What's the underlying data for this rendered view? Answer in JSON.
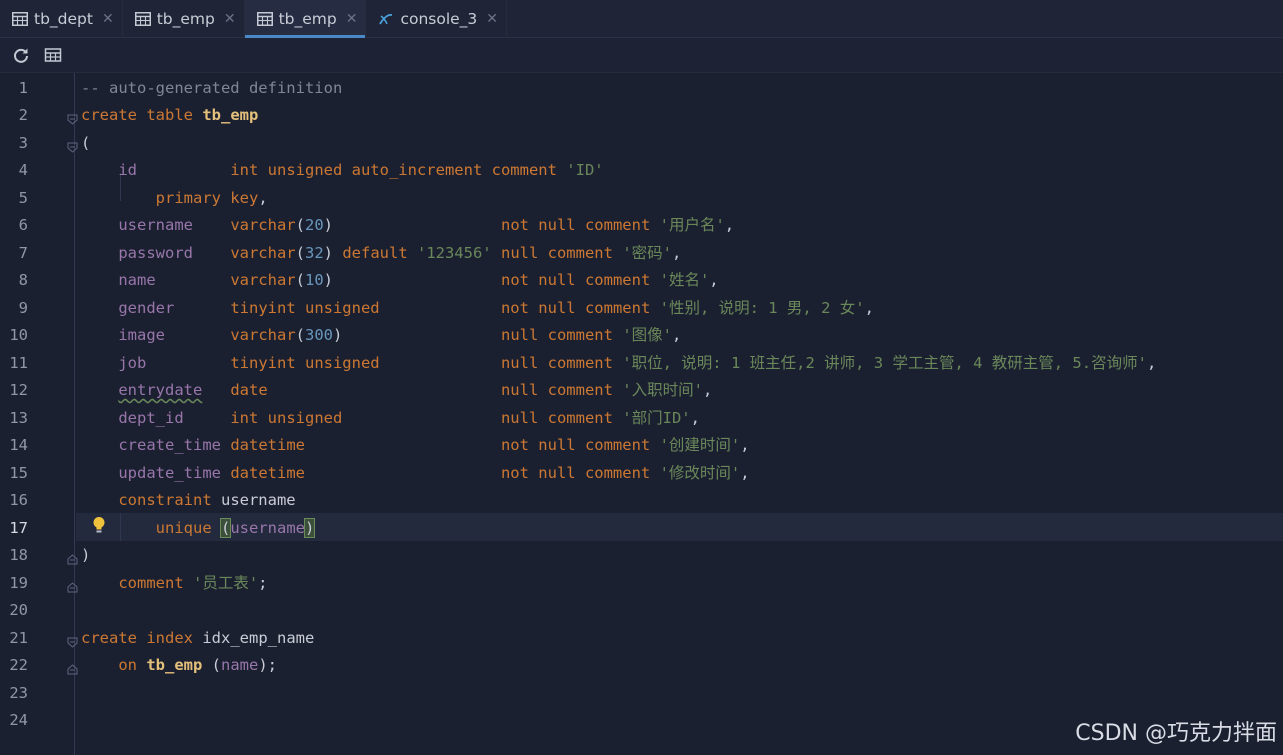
{
  "tabs": [
    {
      "label": "tb_dept",
      "icon": "table-icon",
      "active": false
    },
    {
      "label": "tb_emp",
      "icon": "table-icon",
      "active": false
    },
    {
      "label": "tb_emp",
      "icon": "table-icon",
      "active": true
    },
    {
      "label": "console_3",
      "icon": "console-icon",
      "active": false
    }
  ],
  "toolbar": {
    "buttons": [
      {
        "icon": "refresh-icon"
      },
      {
        "icon": "table-view-icon"
      }
    ]
  },
  "editor": {
    "current_line": 17,
    "line_numbers": [
      "1",
      "2",
      "3",
      "4",
      "5",
      "6",
      "7",
      "8",
      "9",
      "10",
      "11",
      "12",
      "13",
      "14",
      "15",
      "16",
      "17",
      "18",
      "19",
      "20",
      "21",
      "22",
      "23",
      "24"
    ],
    "lines": [
      [
        {
          "t": "-- auto-generated definition",
          "c": "cm"
        }
      ],
      [
        {
          "t": "create table ",
          "c": "kw"
        },
        {
          "t": "tb_emp",
          "c": "tb"
        }
      ],
      [
        {
          "t": "(",
          "c": "par"
        }
      ],
      [
        {
          "t": "    "
        },
        {
          "t": "id",
          "c": "fld"
        },
        {
          "t": "          "
        },
        {
          "t": "int unsigned auto_increment comment ",
          "c": "kw"
        },
        {
          "t": "'ID'",
          "c": "str"
        }
      ],
      [
        {
          "t": "        "
        },
        {
          "t": "primary key",
          "c": "kw"
        },
        {
          "t": ",",
          "c": "par"
        }
      ],
      [
        {
          "t": "    "
        },
        {
          "t": "username",
          "c": "fld"
        },
        {
          "t": "    "
        },
        {
          "t": "varchar",
          "c": "kw"
        },
        {
          "t": "(",
          "c": "par"
        },
        {
          "t": "20",
          "c": "num"
        },
        {
          "t": ")",
          "c": "par"
        },
        {
          "t": "                  "
        },
        {
          "t": "not null comment ",
          "c": "kw"
        },
        {
          "t": "'用户名'",
          "c": "str"
        },
        {
          "t": ",",
          "c": "par"
        }
      ],
      [
        {
          "t": "    "
        },
        {
          "t": "password",
          "c": "fld"
        },
        {
          "t": "    "
        },
        {
          "t": "varchar",
          "c": "kw"
        },
        {
          "t": "(",
          "c": "par"
        },
        {
          "t": "32",
          "c": "num"
        },
        {
          "t": ") ",
          "c": "par"
        },
        {
          "t": "default ",
          "c": "kw"
        },
        {
          "t": "'123456' ",
          "c": "str"
        },
        {
          "t": "null comment ",
          "c": "kw"
        },
        {
          "t": "'密码'",
          "c": "str"
        },
        {
          "t": ",",
          "c": "par"
        }
      ],
      [
        {
          "t": "    "
        },
        {
          "t": "name",
          "c": "fld"
        },
        {
          "t": "        "
        },
        {
          "t": "varchar",
          "c": "kw"
        },
        {
          "t": "(",
          "c": "par"
        },
        {
          "t": "10",
          "c": "num"
        },
        {
          "t": ")",
          "c": "par"
        },
        {
          "t": "                  "
        },
        {
          "t": "not null comment ",
          "c": "kw"
        },
        {
          "t": "'姓名'",
          "c": "str"
        },
        {
          "t": ",",
          "c": "par"
        }
      ],
      [
        {
          "t": "    "
        },
        {
          "t": "gender",
          "c": "fld"
        },
        {
          "t": "      "
        },
        {
          "t": "tinyint unsigned",
          "c": "kw"
        },
        {
          "t": "             "
        },
        {
          "t": "not null comment ",
          "c": "kw"
        },
        {
          "t": "'性别, 说明: 1 男, 2 女'",
          "c": "str"
        },
        {
          "t": ",",
          "c": "par"
        }
      ],
      [
        {
          "t": "    "
        },
        {
          "t": "image",
          "c": "fld"
        },
        {
          "t": "       "
        },
        {
          "t": "varchar",
          "c": "kw"
        },
        {
          "t": "(",
          "c": "par"
        },
        {
          "t": "300",
          "c": "num"
        },
        {
          "t": ")",
          "c": "par"
        },
        {
          "t": "                 "
        },
        {
          "t": "null comment ",
          "c": "kw"
        },
        {
          "t": "'图像'",
          "c": "str"
        },
        {
          "t": ",",
          "c": "par"
        }
      ],
      [
        {
          "t": "    "
        },
        {
          "t": "job",
          "c": "fld"
        },
        {
          "t": "         "
        },
        {
          "t": "tinyint unsigned",
          "c": "kw"
        },
        {
          "t": "             "
        },
        {
          "t": "null comment ",
          "c": "kw"
        },
        {
          "t": "'职位, 说明: 1 班主任,2 讲师, 3 学工主管, 4 教研主管, 5.咨询师'",
          "c": "str"
        },
        {
          "t": ",",
          "c": "par"
        }
      ],
      [
        {
          "t": "    "
        },
        {
          "t": "entrydate",
          "c": "fld wavy"
        },
        {
          "t": "   "
        },
        {
          "t": "date",
          "c": "kw"
        },
        {
          "t": "                         "
        },
        {
          "t": "null comment ",
          "c": "kw"
        },
        {
          "t": "'入职时间'",
          "c": "str"
        },
        {
          "t": ",",
          "c": "par"
        }
      ],
      [
        {
          "t": "    "
        },
        {
          "t": "dept_id",
          "c": "fld"
        },
        {
          "t": "     "
        },
        {
          "t": "int unsigned",
          "c": "kw"
        },
        {
          "t": "                 "
        },
        {
          "t": "null comment ",
          "c": "kw"
        },
        {
          "t": "'部门ID'",
          "c": "str"
        },
        {
          "t": ",",
          "c": "par"
        }
      ],
      [
        {
          "t": "    "
        },
        {
          "t": "create_time",
          "c": "fld"
        },
        {
          "t": " "
        },
        {
          "t": "datetime",
          "c": "kw"
        },
        {
          "t": "                     "
        },
        {
          "t": "not null comment ",
          "c": "kw"
        },
        {
          "t": "'创建时间'",
          "c": "str"
        },
        {
          "t": ",",
          "c": "par"
        }
      ],
      [
        {
          "t": "    "
        },
        {
          "t": "update_time",
          "c": "fld"
        },
        {
          "t": " "
        },
        {
          "t": "datetime",
          "c": "kw"
        },
        {
          "t": "                     "
        },
        {
          "t": "not null comment ",
          "c": "kw"
        },
        {
          "t": "'修改时间'",
          "c": "str"
        },
        {
          "t": ",",
          "c": "par"
        }
      ],
      [
        {
          "t": "    "
        },
        {
          "t": "constraint ",
          "c": "kw"
        },
        {
          "t": "username",
          "c": "par"
        }
      ],
      [
        {
          "t": "        "
        },
        {
          "t": "unique ",
          "c": "kw"
        },
        {
          "t": "(",
          "c": "par hl"
        },
        {
          "t": "username",
          "c": "fld"
        },
        {
          "t": ")",
          "c": "par hl"
        }
      ],
      [
        {
          "t": ")",
          "c": "par"
        }
      ],
      [
        {
          "t": "    "
        },
        {
          "t": "comment ",
          "c": "kw"
        },
        {
          "t": "'员工表'",
          "c": "str"
        },
        {
          "t": ";",
          "c": "par"
        }
      ],
      [],
      [
        {
          "t": "create index ",
          "c": "kw"
        },
        {
          "t": "idx_emp_name",
          "c": "par"
        }
      ],
      [
        {
          "t": "    "
        },
        {
          "t": "on ",
          "c": "kw"
        },
        {
          "t": "tb_emp",
          "c": "tb"
        },
        {
          "t": " ("
        },
        {
          "t": "name",
          "c": "fld"
        },
        {
          "t": ")",
          "c": "par"
        },
        {
          "t": ";",
          "c": "par"
        }
      ],
      [],
      []
    ]
  },
  "watermark": "CSDN @巧克力拌面"
}
